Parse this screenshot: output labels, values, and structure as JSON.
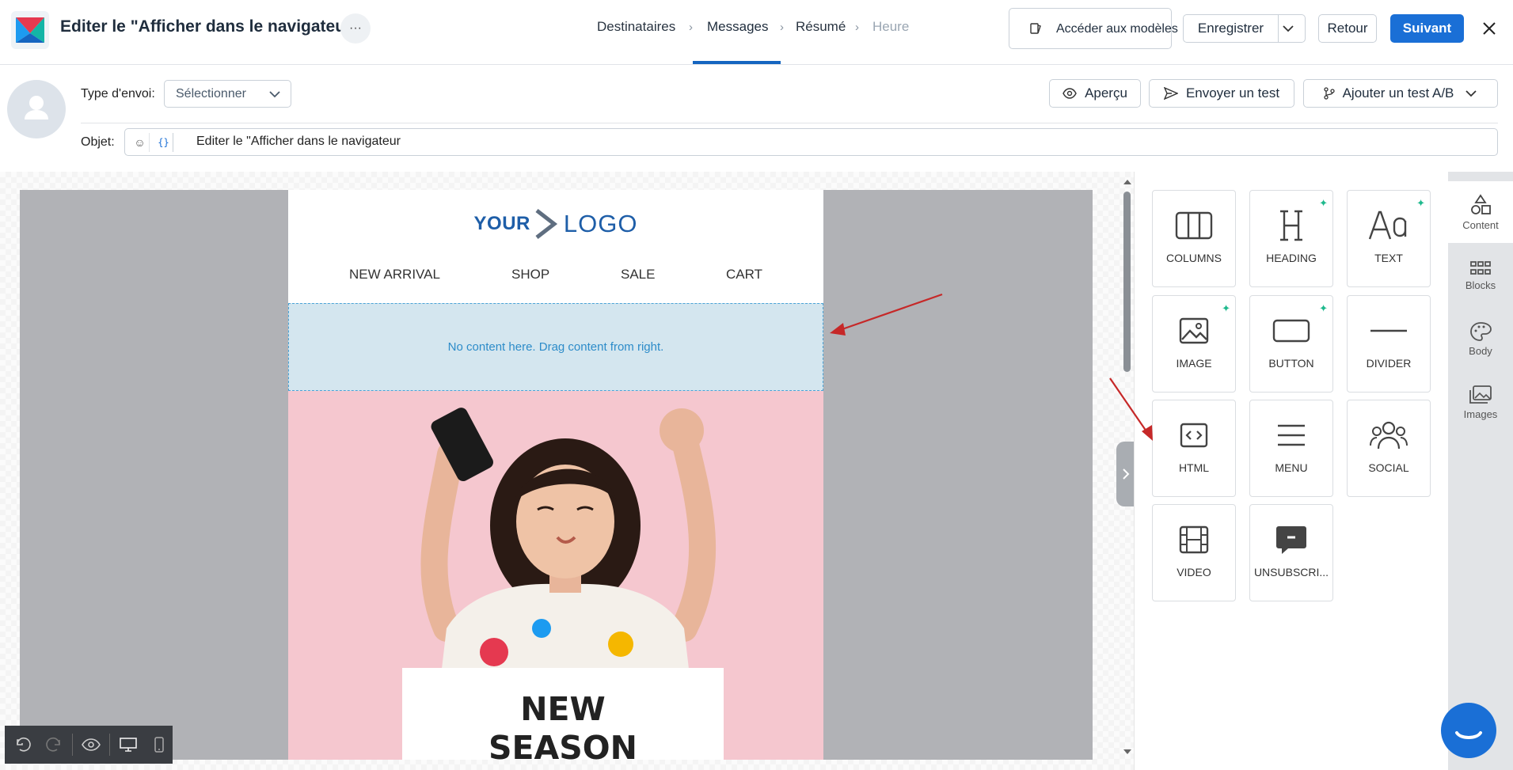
{
  "header": {
    "title": "Editer le \"Afficher dans le navigateur\"",
    "more_label": "···",
    "steps": [
      {
        "label": "Destinataires",
        "state": "done"
      },
      {
        "label": "Messages",
        "state": "active"
      },
      {
        "label": "Résumé",
        "state": "done"
      },
      {
        "label": "Heure",
        "state": "disabled"
      }
    ],
    "models_label": "Accéder aux modèles",
    "save_label": "Enregistrer",
    "back_label": "Retour",
    "next_label": "Suivant"
  },
  "settings": {
    "send_type_label": "Type d'envoi:",
    "send_type_value": "Sélectionner",
    "subject_label": "Objet:",
    "subject_value": "Editer le \"Afficher dans le navigateur",
    "preview_label": "Aperçu",
    "send_test_label": "Envoyer un test",
    "ab_test_label": "Ajouter un test A/B"
  },
  "email": {
    "logo_your": "YOUR",
    "logo_logo": "LOGO",
    "nav": [
      "NEW ARRIVAL",
      "SHOP",
      "SALE",
      "CART"
    ],
    "dropzone_text": "No content here. Drag content from right.",
    "hero_title_line1": "NEW",
    "hero_title_line2": "SEASON"
  },
  "content_tiles": [
    {
      "label": "COLUMNS",
      "icon": "columns-icon",
      "ai": false
    },
    {
      "label": "HEADING",
      "icon": "heading-icon",
      "ai": true
    },
    {
      "label": "TEXT",
      "icon": "text-icon",
      "ai": true
    },
    {
      "label": "IMAGE",
      "icon": "image-icon",
      "ai": true
    },
    {
      "label": "BUTTON",
      "icon": "button-icon",
      "ai": true
    },
    {
      "label": "DIVIDER",
      "icon": "divider-icon",
      "ai": false
    },
    {
      "label": "HTML",
      "icon": "html-icon",
      "ai": false
    },
    {
      "label": "MENU",
      "icon": "menu-icon",
      "ai": false
    },
    {
      "label": "SOCIAL",
      "icon": "social-icon",
      "ai": false
    },
    {
      "label": "VIDEO",
      "icon": "video-icon",
      "ai": false
    },
    {
      "label": "UNSUBSCRI...",
      "icon": "unsubscribe-icon",
      "ai": false
    }
  ],
  "side_tabs": [
    {
      "label": "Content",
      "icon": "shapes-icon",
      "active": true
    },
    {
      "label": "Blocks",
      "icon": "grid-icon",
      "active": false
    },
    {
      "label": "Body",
      "icon": "palette-icon",
      "active": false
    },
    {
      "label": "Images",
      "icon": "images-icon",
      "active": false
    }
  ],
  "colors": {
    "primary": "#1a6fd6",
    "ai_sparkle": "#1fb98d",
    "annotation_arrow": "#c62828"
  }
}
